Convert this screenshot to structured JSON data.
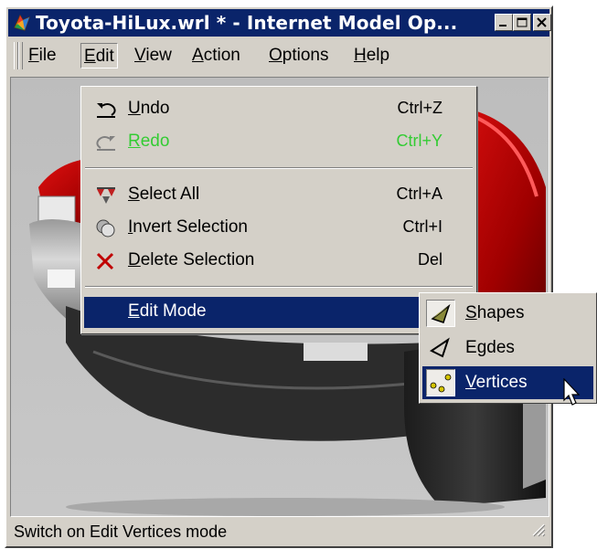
{
  "window": {
    "title": "Toyota-HiLux.wrl * - Internet Model Op...",
    "title_icon": "app-icon",
    "buttons": [
      "minimize-icon",
      "maximize-icon",
      "close-icon"
    ]
  },
  "menubar": {
    "items": [
      {
        "label": "File",
        "mnemonic": "F"
      },
      {
        "label": "Edit",
        "mnemonic": "E"
      },
      {
        "label": "View",
        "mnemonic": "V"
      },
      {
        "label": "Action",
        "mnemonic": "A"
      },
      {
        "label": "Options",
        "mnemonic": "O"
      },
      {
        "label": "Help",
        "mnemonic": "H"
      }
    ],
    "open": "Edit"
  },
  "edit_menu": {
    "items": [
      {
        "label": "Undo",
        "shortcut": "Ctrl+Z",
        "icon": "undo-icon",
        "enabled": true
      },
      {
        "label": "Redo",
        "shortcut": "Ctrl+Y",
        "icon": "redo-icon",
        "enabled": false
      },
      {
        "label": "Select All",
        "shortcut": "Ctrl+A",
        "icon": "select-all-icon",
        "enabled": true
      },
      {
        "label": "Invert Selection",
        "shortcut": "Ctrl+I",
        "icon": "invert-selection-icon",
        "enabled": true
      },
      {
        "label": "Delete Selection",
        "shortcut": "Del",
        "icon": "delete-icon",
        "enabled": true
      },
      {
        "label": "Edit Mode",
        "shortcut": "",
        "icon": "",
        "enabled": true,
        "submenu": true,
        "highlighted": true
      }
    ]
  },
  "edit_mode_submenu": {
    "items": [
      {
        "label": "Shapes",
        "icon": "shapes-icon",
        "checked": true
      },
      {
        "label": "Egdes",
        "icon": "edges-icon",
        "checked": false
      },
      {
        "label": "Vertices",
        "icon": "vertices-icon",
        "checked": true,
        "highlighted": true
      }
    ]
  },
  "statusbar": {
    "text": "Switch on Edit Vertices mode"
  },
  "colors": {
    "title_bg": "#0a246a",
    "highlight": "#0a246a",
    "face": "#d4d0c8",
    "disabled_text": "#33cc33",
    "car_red": "#b00000"
  }
}
